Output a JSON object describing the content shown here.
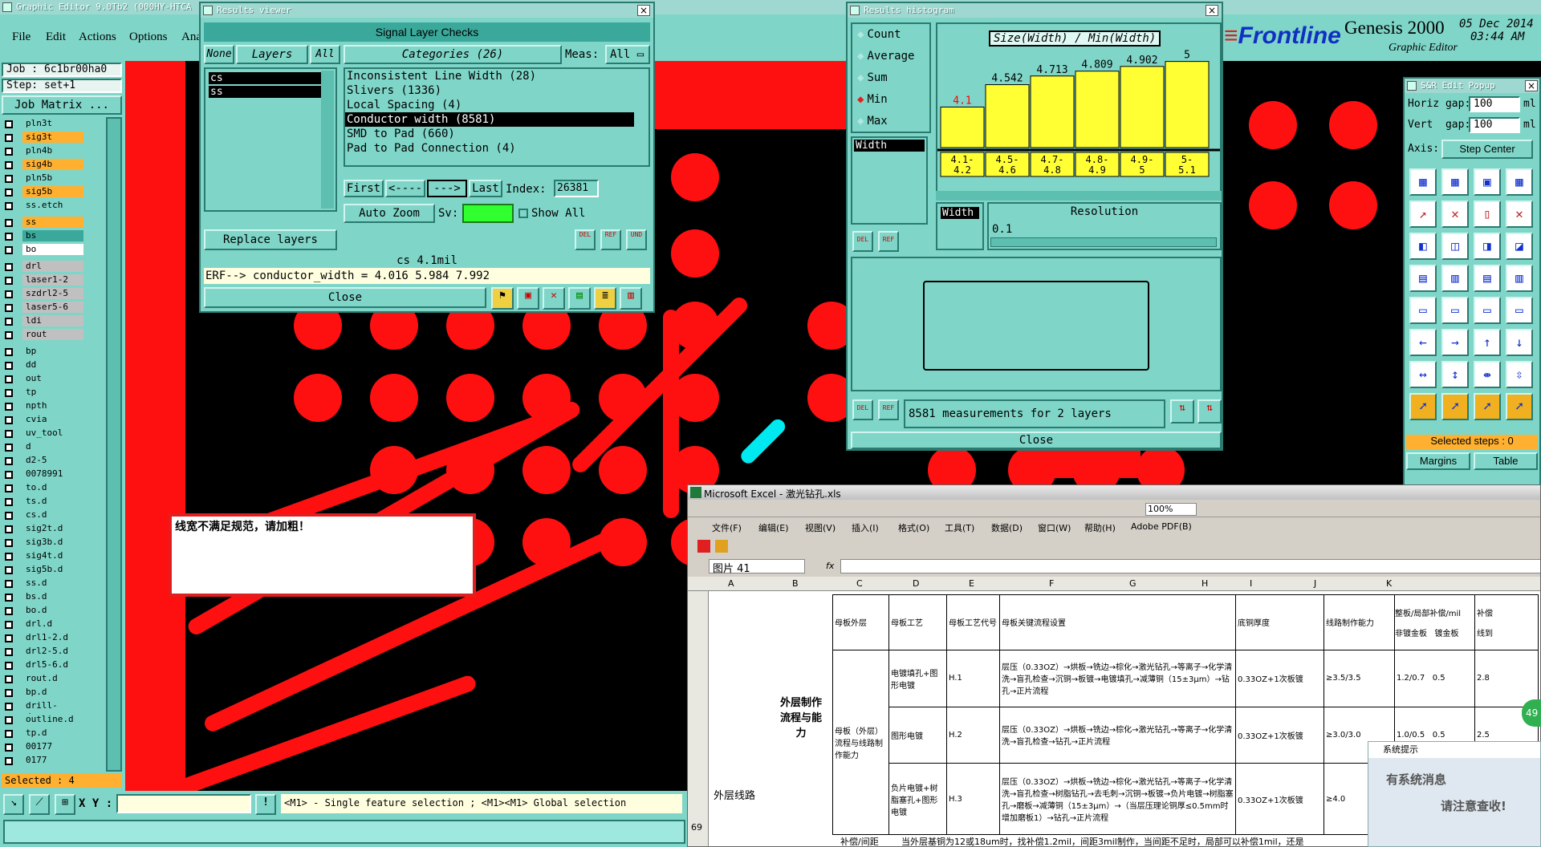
{
  "app": {
    "title": "Graphic Editor 9.0Tb2 (000HY-HTCA",
    "menu": [
      "File",
      "Edit",
      "Actions",
      "Options",
      "Ana"
    ],
    "job_label": "Job : 6c1br00ha0",
    "step_label": "Step: set+1",
    "job_matrix_btn": "Job Matrix ...",
    "selected_label": "Selected : 4",
    "xy_label": "X Y :",
    "status_hint": "<M1> - Single feature selection ; <M1><M1> Global selection",
    "brand": "Frontline",
    "brand_prefix": "≡",
    "product": "Genesis 2000",
    "product_sub": "Graphic Editor",
    "date": "05 Dec 2014",
    "time": "03:44 AM"
  },
  "layers": {
    "group1": [
      {
        "name": "pln3t",
        "color": "#7fd6c8"
      },
      {
        "name": "sig3t",
        "color": "#ffb030"
      },
      {
        "name": "pln4b",
        "color": "#7fd6c8"
      },
      {
        "name": "sig4b",
        "color": "#ffb030"
      },
      {
        "name": "pln5b",
        "color": "#7fd6c8"
      },
      {
        "name": "sig5b",
        "color": "#ffb030"
      },
      {
        "name": "ss.etch",
        "color": "#7fd6c8"
      }
    ],
    "group2": [
      {
        "name": "ss",
        "color": "#ffb030"
      },
      {
        "name": "bs",
        "color": "#3aa89a"
      },
      {
        "name": "bo",
        "color": "#ffffff"
      }
    ],
    "group3": [
      {
        "name": "drl",
        "color": "#c0c0c0"
      },
      {
        "name": "laser1-2",
        "color": "#c0c0c0"
      },
      {
        "name": "szdrl2-5",
        "color": "#c0c0c0"
      },
      {
        "name": "laser5-6",
        "color": "#c0c0c0"
      },
      {
        "name": "ldi",
        "color": "#c0c0c0"
      },
      {
        "name": "rout",
        "color": "#c0c0c0"
      }
    ],
    "group4": [
      {
        "name": "bp",
        "color": "#7fd6c8"
      },
      {
        "name": "dd",
        "color": "#7fd6c8"
      },
      {
        "name": "out",
        "color": "#7fd6c8"
      },
      {
        "name": "tp",
        "color": "#7fd6c8"
      },
      {
        "name": "npth",
        "color": "#7fd6c8"
      },
      {
        "name": "cvia",
        "color": "#7fd6c8"
      },
      {
        "name": "uv_tool",
        "color": "#7fd6c8"
      },
      {
        "name": "d",
        "color": "#7fd6c8"
      },
      {
        "name": "d2-5",
        "color": "#7fd6c8"
      },
      {
        "name": "0078991",
        "color": "#7fd6c8"
      },
      {
        "name": "to.d",
        "color": "#7fd6c8"
      },
      {
        "name": "ts.d",
        "color": "#7fd6c8"
      },
      {
        "name": "cs.d",
        "color": "#7fd6c8"
      },
      {
        "name": "sig2t.d",
        "color": "#7fd6c8"
      },
      {
        "name": "sig3b.d",
        "color": "#7fd6c8"
      },
      {
        "name": "sig4t.d",
        "color": "#7fd6c8"
      },
      {
        "name": "sig5b.d",
        "color": "#7fd6c8"
      },
      {
        "name": "ss.d",
        "color": "#7fd6c8"
      },
      {
        "name": "bs.d",
        "color": "#7fd6c8"
      },
      {
        "name": "bo.d",
        "color": "#7fd6c8"
      },
      {
        "name": "drl.d",
        "color": "#7fd6c8"
      },
      {
        "name": "drl1-2.d",
        "color": "#7fd6c8"
      },
      {
        "name": "drl2-5.d",
        "color": "#7fd6c8"
      },
      {
        "name": "drl5-6.d",
        "color": "#7fd6c8"
      },
      {
        "name": "rout.d",
        "color": "#7fd6c8"
      },
      {
        "name": "bp.d",
        "color": "#7fd6c8"
      },
      {
        "name": "drill-draw.",
        "color": "#7fd6c8"
      },
      {
        "name": "outline.d",
        "color": "#7fd6c8"
      },
      {
        "name": "tp.d",
        "color": "#7fd6c8"
      },
      {
        "name": "00177",
        "color": "#7fd6c8"
      },
      {
        "name": "0177",
        "color": "#7fd6c8"
      }
    ]
  },
  "results_viewer": {
    "title": "Results viewer",
    "header": "Signal Layer Checks",
    "tab_none": "None",
    "tab_layers": "Layers",
    "tab_all": "All",
    "categories_label": "Categories (26)",
    "meas_label": "Meas:",
    "meas_value": "All",
    "layer_list": [
      "cs",
      "ss"
    ],
    "categories": [
      "Inconsistent Line Width (28)",
      "Slivers (1336)",
      "Local Spacing (4)",
      "Conductor width (8581)",
      "SMD to Pad (660)",
      "Pad to Pad Connection (4)"
    ],
    "selected_category_index": 3,
    "first": "First",
    "prev": "<----",
    "next": "--->",
    "last": "Last",
    "index_label": "Index:",
    "index_value": "26381",
    "auto_zoom": "Auto Zoom",
    "sv_label": "Sv:",
    "show_all": "Show All",
    "replace_layers": "Replace layers",
    "del": "DEL",
    "ref": "REF",
    "und": "UND",
    "cs_info": "cs 4.1mil",
    "erf_line": "ERF--> conductor_width = 4.016 5.984 7.992",
    "close": "Close"
  },
  "histogram": {
    "title": "Results histogram",
    "options": [
      "Count",
      "Average",
      "Sum",
      "Min",
      "Max"
    ],
    "selected_option": "Min",
    "attr_list_item": "Width",
    "chart_title": "Size(Width) / Min(Width)",
    "resolution_label": "Resolution",
    "resolution_value": "0.1",
    "width_label": "Width",
    "summary": "8581 measurements for 2 layers",
    "close": "Close",
    "del": "DEL",
    "ref": "REF"
  },
  "chart_data": {
    "type": "bar",
    "title": "Size(Width) / Min(Width)",
    "categories": [
      "4.1-4.2",
      "4.5-4.6",
      "4.7-4.8",
      "4.8-4.9",
      "4.9-5",
      "5-5.1"
    ],
    "values": [
      4.1,
      4.542,
      4.713,
      4.809,
      4.902,
      5
    ],
    "labels": [
      "4.1",
      "4.542",
      "4.713",
      "4.809",
      "4.902",
      "5"
    ],
    "ylim": [
      3.3,
      5.2
    ],
    "colors": {
      "bar": "#ffff33",
      "first_label": "#ff0000",
      "label": "#000000"
    }
  },
  "sr_popup": {
    "title": "S&R Edit Popup",
    "horiz_label": "Horiz gap:",
    "horiz_value": "100",
    "horiz_unit": "ml",
    "vert_label": "Vert  gap:",
    "vert_value": "100",
    "vert_unit": "ml",
    "axis_label": "Axis:",
    "axis_value": "Step Center",
    "selected_steps": "Selected steps : 0",
    "margins": "Margins",
    "table": "Table"
  },
  "message_box": {
    "text": "线宽不满足规范，请加粗！"
  },
  "excel": {
    "title": "Microsoft Excel - 激光钻孔.xls",
    "menu": [
      "文件(F)",
      "编辑(E)",
      "视图(V)",
      "插入(I)",
      "格式(O)",
      "工具(T)",
      "数据(D)",
      "窗口(W)",
      "帮助(H)",
      "Adobe PDF(B)"
    ],
    "zoom": "100%",
    "name_box": "图片 41",
    "fx": "fx",
    "columns": [
      "A",
      "B",
      "C",
      "D",
      "E",
      "F",
      "G",
      "H",
      "I",
      "J",
      "K"
    ],
    "row_number": "69",
    "headers": [
      "母板外层",
      "母板工艺",
      "母板工艺代号",
      "母板关键流程设置",
      "底铜厚度",
      "线路制作能力",
      "整板/局部补偿/mil",
      "非镀金板",
      "镀金板",
      "补偿",
      "线到"
    ],
    "cell_a": "外层线路",
    "cell_b": "外层制作流程与能力",
    "cell_c": "母板（外层）流程与线路制作能力",
    "rows": [
      {
        "tech": "电镀填孔+图形电镀",
        "code": "H.1",
        "flow": "层压（0.33OZ）→烘板→铣边→棕化→激光钻孔→等离子→化学清洗→盲孔检查→沉铜→板镀→电镀填孔→减薄铜（15±3μm）→钻孔→正片流程",
        "cu": "0.33OZ+1次板镀",
        "ability": "≥3.5/3.5",
        "nongold": "1.2/0.7",
        "gold": "0.5",
        "extra": "2.8"
      },
      {
        "tech": "图形电镀",
        "code": "H.2",
        "flow": "层压（0.33OZ）→烘板→铣边→棕化→激光钻孔→等离子→化学清洗→盲孔检查→钻孔→正片流程",
        "cu": "0.33OZ+1次板镀",
        "ability": "≥3.0/3.0",
        "nongold": "1.0/0.5",
        "gold": "0.5",
        "extra": "2.5"
      },
      {
        "tech": "负片电镀+树脂塞孔+图形电镀",
        "code": "H.3",
        "flow": "层压（0.33OZ）→烘板→铣边→棕化→激光钻孔→等离子→化学清洗→盲孔检查→树脂钻孔→去毛刺→沉铜→板镀→负片电镀→树脂塞孔→磨板→减薄铜（15±3μm）→（当层压理论铜厚≤0.5mm时增加磨板1）→钻孔→正片流程",
        "cu": "0.33OZ+1次板镀",
        "ability": "≥4.0",
        "nongold": "",
        "gold": "",
        "extra": ""
      }
    ],
    "bottom_cell": "补偿/间距",
    "bottom_note": "当外层基铜为12或18um时，找补偿1.2mil，间距3mil制作，当间距不足时，局部可以补偿1mil，还是"
  },
  "notify": {
    "title": "系统提示",
    "line1": "有系统消息",
    "line2": "请注意查收!"
  },
  "badge": "49"
}
